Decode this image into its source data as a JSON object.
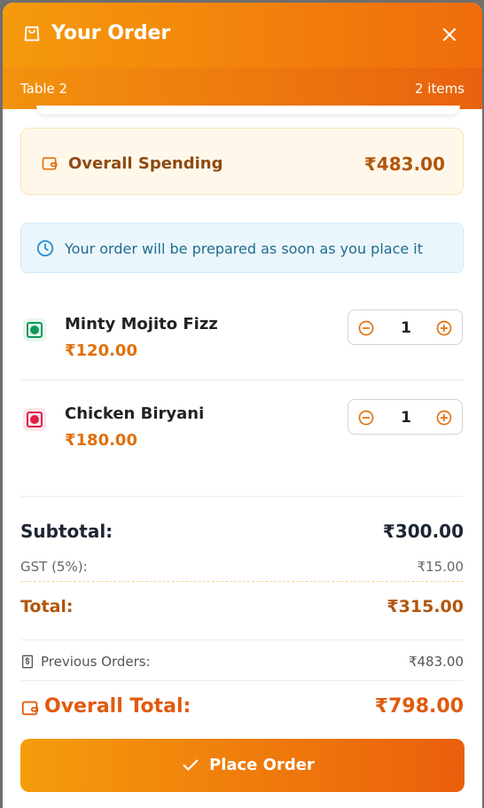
{
  "header": {
    "title": "Your Order",
    "table": "Table 2",
    "items_count": "2 items"
  },
  "spending": {
    "label": "Overall Spending",
    "amount": "₹483.00"
  },
  "info": {
    "text": "Your order will be prepared as soon as you place it"
  },
  "items": [
    {
      "name": "Minty Mojito Fizz",
      "price": "₹120.00",
      "qty": "1",
      "type": "veg"
    },
    {
      "name": "Chicken Biryani",
      "price": "₹180.00",
      "qty": "1",
      "type": "non-veg"
    }
  ],
  "summary": {
    "subtotal_label": "Subtotal:",
    "subtotal": "₹300.00",
    "gst_label": "GST (5%):",
    "gst": "₹15.00",
    "total_label": "Total:",
    "total": "₹315.00",
    "previous_label": "Previous Orders:",
    "previous": "₹483.00",
    "overall_label": "Overall Total:",
    "overall": "₹798.00"
  },
  "place_order_label": "Place Order",
  "colors": {
    "accent": "#ef6c0c",
    "veg": "#0e9a5a",
    "nonveg": "#e11d48"
  }
}
